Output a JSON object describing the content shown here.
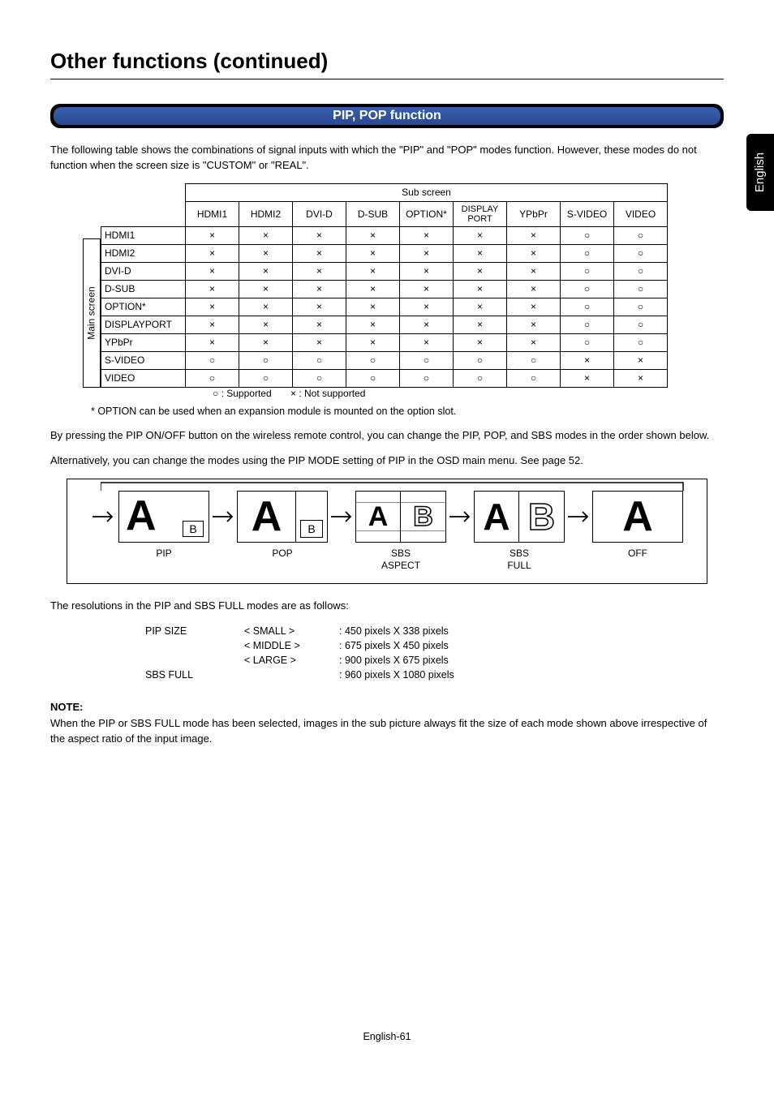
{
  "langTab": "English",
  "pageTitle": "Other functions (continued)",
  "sectionTitle": "PIP, POP function",
  "intro": "The following table shows the combinations of signal inputs with which the \"PIP\" and \"POP\" modes function. However, these modes do not function when the screen size is \"CUSTOM\" or \"REAL\".",
  "tableAxisTop": "Sub screen",
  "tableAxisLeft": "Main screen",
  "cols": [
    "HDMI1",
    "HDMI2",
    "DVI-D",
    "D-SUB",
    "OPTION*",
    "DISPLAY PORT",
    "YPbPr",
    "S-VIDEO",
    "VIDEO"
  ],
  "rows": [
    {
      "label": "HDMI1",
      "cells": [
        "×",
        "×",
        "×",
        "×",
        "×",
        "×",
        "×",
        "○",
        "○"
      ]
    },
    {
      "label": "HDMI2",
      "cells": [
        "×",
        "×",
        "×",
        "×",
        "×",
        "×",
        "×",
        "○",
        "○"
      ]
    },
    {
      "label": "DVI-D",
      "cells": [
        "×",
        "×",
        "×",
        "×",
        "×",
        "×",
        "×",
        "○",
        "○"
      ]
    },
    {
      "label": "D-SUB",
      "cells": [
        "×",
        "×",
        "×",
        "×",
        "×",
        "×",
        "×",
        "○",
        "○"
      ]
    },
    {
      "label": "OPTION*",
      "cells": [
        "×",
        "×",
        "×",
        "×",
        "×",
        "×",
        "×",
        "○",
        "○"
      ]
    },
    {
      "label": "DISPLAYPORT",
      "cells": [
        "×",
        "×",
        "×",
        "×",
        "×",
        "×",
        "×",
        "○",
        "○"
      ]
    },
    {
      "label": "YPbPr",
      "cells": [
        "×",
        "×",
        "×",
        "×",
        "×",
        "×",
        "×",
        "○",
        "○"
      ]
    },
    {
      "label": "S-VIDEO",
      "cells": [
        "○",
        "○",
        "○",
        "○",
        "○",
        "○",
        "○",
        "×",
        "×"
      ]
    },
    {
      "label": "VIDEO",
      "cells": [
        "○",
        "○",
        "○",
        "○",
        "○",
        "○",
        "○",
        "×",
        "×"
      ]
    }
  ],
  "legendSupported": "○ : Supported",
  "legendNotSupported": "× : Not supported",
  "optionNote": "* OPTION can be used when an expansion module is mounted on the option slot.",
  "para2a": "By pressing the PIP ON/OFF button on the wireless remote control, you can change the PIP, POP, and SBS modes in the order shown below.",
  "para2b": "Alternatively, you can change the modes using the PIP MODE setting of PIP in the OSD main menu. See page 52.",
  "modes": {
    "pip": "PIP",
    "pop": "POP",
    "sbsAspect": "SBS\nASPECT",
    "sbsFull": "SBS\nFULL",
    "off": "OFF"
  },
  "resIntro": "The resolutions in the PIP and SBS FULL modes are as follows:",
  "resRows": [
    {
      "c0": "PIP SIZE",
      "c1": "< SMALL >",
      "c2": ": 450 pixels X 338 pixels"
    },
    {
      "c0": "",
      "c1": "< MIDDLE >",
      "c2": ": 675 pixels X 450 pixels"
    },
    {
      "c0": "",
      "c1": "< LARGE >",
      "c2": ": 900 pixels X 675 pixels"
    },
    {
      "c0": "SBS FULL",
      "c1": "",
      "c2": ": 960 pixels X 1080 pixels"
    }
  ],
  "noteTitle": "NOTE:",
  "noteBody": "When the PIP or SBS FULL mode has been selected, images in the sub picture always fit the size of each mode shown above irrespective of the aspect ratio of the input image.",
  "footer": "English-61",
  "chart_data": {
    "type": "table",
    "title": "PIP/POP signal input compatibility matrix",
    "row_axis": "Main screen",
    "col_axis": "Sub screen",
    "columns": [
      "HDMI1",
      "HDMI2",
      "DVI-D",
      "D-SUB",
      "OPTION*",
      "DISPLAY PORT",
      "YPbPr",
      "S-VIDEO",
      "VIDEO"
    ],
    "rows": [
      "HDMI1",
      "HDMI2",
      "DVI-D",
      "D-SUB",
      "OPTION*",
      "DISPLAYPORT",
      "YPbPr",
      "S-VIDEO",
      "VIDEO"
    ],
    "legend": {
      "○": "Supported",
      "×": "Not supported"
    },
    "matrix": [
      [
        "×",
        "×",
        "×",
        "×",
        "×",
        "×",
        "×",
        "○",
        "○"
      ],
      [
        "×",
        "×",
        "×",
        "×",
        "×",
        "×",
        "×",
        "○",
        "○"
      ],
      [
        "×",
        "×",
        "×",
        "×",
        "×",
        "×",
        "×",
        "○",
        "○"
      ],
      [
        "×",
        "×",
        "×",
        "×",
        "×",
        "×",
        "×",
        "○",
        "○"
      ],
      [
        "×",
        "×",
        "×",
        "×",
        "×",
        "×",
        "×",
        "○",
        "○"
      ],
      [
        "×",
        "×",
        "×",
        "×",
        "×",
        "×",
        "×",
        "○",
        "○"
      ],
      [
        "×",
        "×",
        "×",
        "×",
        "×",
        "×",
        "×",
        "○",
        "○"
      ],
      [
        "○",
        "○",
        "○",
        "○",
        "○",
        "○",
        "○",
        "×",
        "×"
      ],
      [
        "○",
        "○",
        "○",
        "○",
        "○",
        "○",
        "○",
        "×",
        "×"
      ]
    ]
  }
}
